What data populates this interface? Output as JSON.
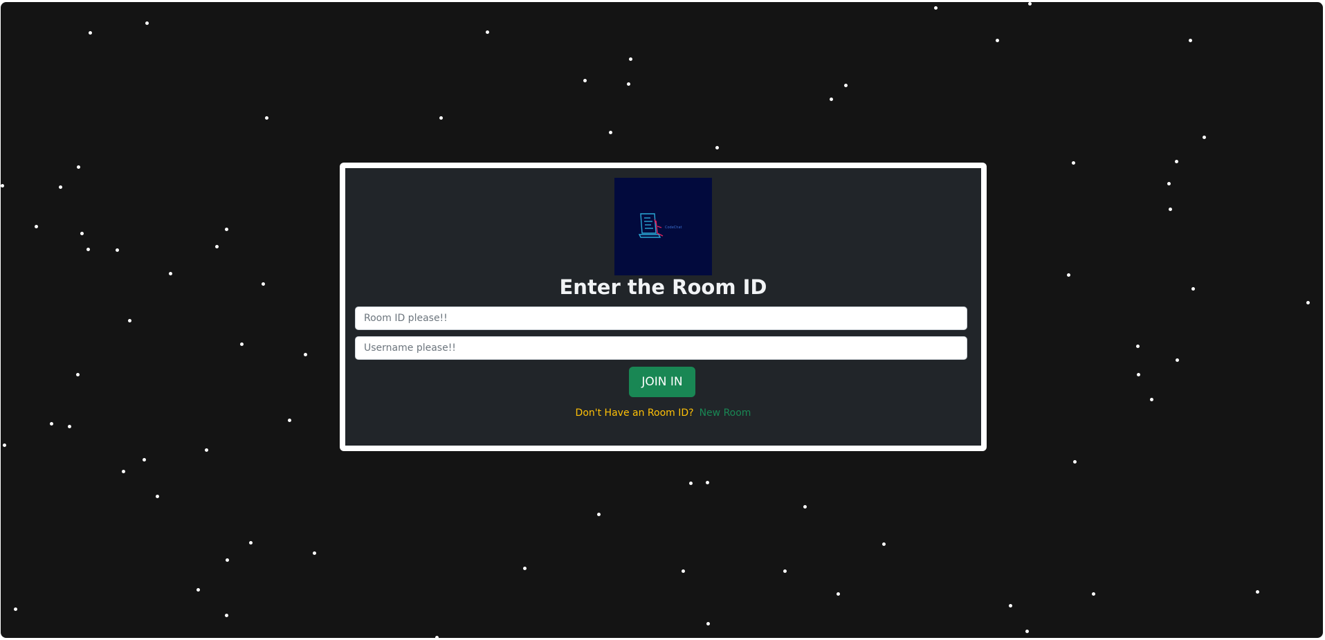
{
  "login": {
    "title": "Enter the Room ID",
    "room_placeholder": "Room ID please!!",
    "username_placeholder": "Username please!!",
    "room_value": "",
    "username_value": "",
    "join_label": "JOIN IN",
    "prompt_text": "Don't Have an Room ID?",
    "new_room_label": "New Room",
    "logo_icon": "laptop-code-logo"
  },
  "colors": {
    "background": "#141414",
    "card": "#212529",
    "button": "#198754",
    "prompt": "#ffc107",
    "link": "#198754",
    "star": "#ffffff"
  }
}
